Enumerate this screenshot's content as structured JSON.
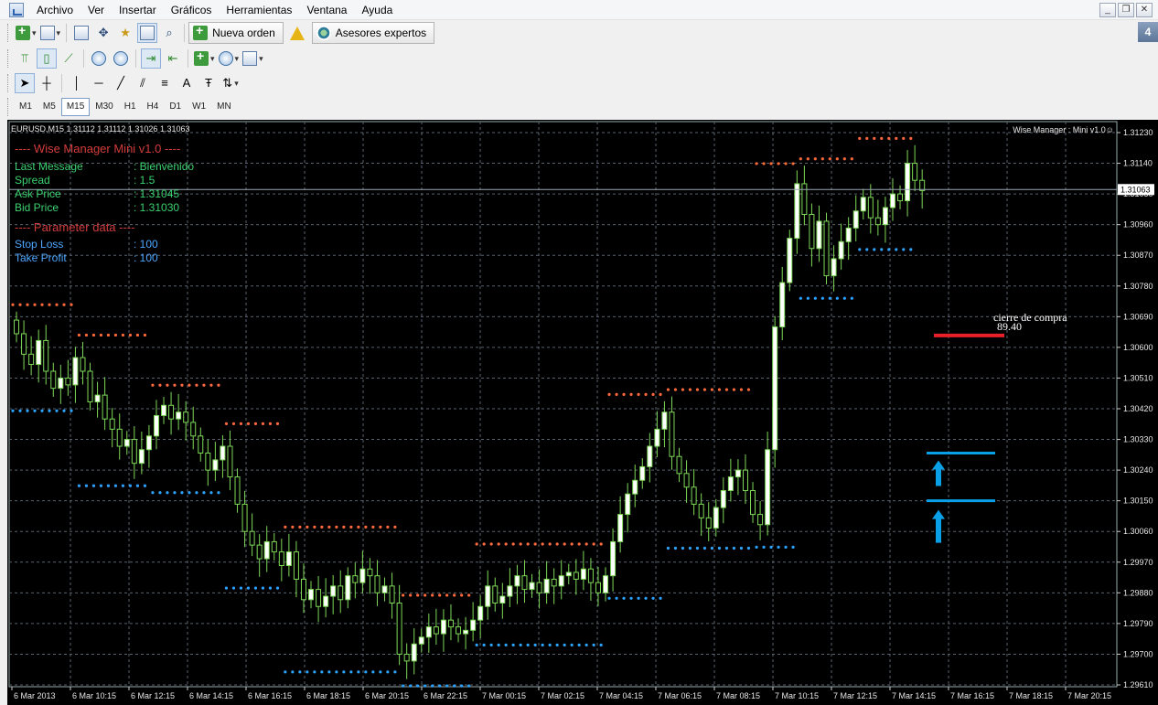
{
  "menubar": {
    "items": [
      "Archivo",
      "Ver",
      "Insertar",
      "Gráficos",
      "Herramientas",
      "Ventana",
      "Ayuda"
    ]
  },
  "window_controls": [
    "_",
    "❐",
    "✕"
  ],
  "toolbar1": {
    "new_order_label": "Nueva orden",
    "expert_advisors_label": "Asesores expertos",
    "badge": "4"
  },
  "timeframes": [
    "M1",
    "M5",
    "M15",
    "M30",
    "H1",
    "H4",
    "D1",
    "W1",
    "MN"
  ],
  "active_timeframe": "M15",
  "chart": {
    "header": "EURUSD,M15  1.31112 1.31112 1.31026 1.31063",
    "ea_label": "Wise Manager : Mini v1.0☺",
    "current_price": "1.31063",
    "colors": {
      "background": "#000000",
      "grid": "#5a6470",
      "bull": "#ffffff",
      "bear": "#7ed957",
      "wick": "#7ed957",
      "resistance_dots": "#ff6a3d",
      "support_dots": "#2ba3ff",
      "close_line": "#e8202a",
      "arrow_blue": "#0aa0e8"
    }
  },
  "panel": {
    "title": "---- Wise Manager Mini v1.0 ----",
    "rows": [
      {
        "label": "Last Message",
        "value": ": Bienvenido"
      },
      {
        "label": "Spread",
        "value": ": 1.5"
      },
      {
        "label": "Ask Price",
        "value": ": 1.31045"
      },
      {
        "label": "Bid Price",
        "value": ": 1.31030"
      }
    ],
    "param_title": "---- Parameter data ----",
    "params": [
      {
        "label": "Stop Loss",
        "value": ": 100"
      },
      {
        "label": "Take Profit",
        "value": ": 100"
      }
    ]
  },
  "annotation": {
    "line1": "cierre de compra",
    "line2": "89.40"
  },
  "chart_data": {
    "type": "candlestick",
    "symbol": "EURUSD",
    "timeframe": "M15",
    "y_ticks": [
      "1.31230",
      "1.31140",
      "1.31050",
      "1.30960",
      "1.30870",
      "1.30780",
      "1.30690",
      "1.30600",
      "1.30510",
      "1.30420",
      "1.30330",
      "1.30240",
      "1.30150",
      "1.30060",
      "1.29970",
      "1.29880",
      "1.29790",
      "1.29700",
      "1.29610"
    ],
    "x_ticks": [
      "6 Mar 2013",
      "6 Mar 10:15",
      "6 Mar 12:15",
      "6 Mar 14:15",
      "6 Mar 16:15",
      "6 Mar 18:15",
      "6 Mar 20:15",
      "6 Mar 22:15",
      "7 Mar 00:15",
      "7 Mar 02:15",
      "7 Mar 04:15",
      "7 Mar 06:15",
      "7 Mar 08:15",
      "7 Mar 10:15",
      "7 Mar 12:15",
      "7 Mar 14:15",
      "7 Mar 16:15",
      "7 Mar 18:15",
      "7 Mar 20:15"
    ],
    "ylim": [
      1.2961,
      1.3123
    ],
    "bid_line": 1.31063,
    "close_marker_price": 1.30635,
    "entry_levels": [
      1.3029,
      1.3015
    ],
    "closes": [
      1.3064,
      1.3058,
      1.3055,
      1.3062,
      1.3053,
      1.3048,
      1.3051,
      1.3049,
      1.3057,
      1.3053,
      1.3044,
      1.3046,
      1.3039,
      1.3036,
      1.3031,
      1.3033,
      1.3026,
      1.303,
      1.3034,
      1.304,
      1.3043,
      1.3039,
      1.3041,
      1.3038,
      1.3034,
      1.3029,
      1.3024,
      1.3027,
      1.3031,
      1.3022,
      1.3014,
      1.3006,
      1.3002,
      1.2998,
      1.3003,
      1.3,
      1.2996,
      1.3,
      1.2992,
      1.2986,
      1.2989,
      1.2984,
      1.2987,
      1.299,
      1.2986,
      1.2993,
      1.2991,
      1.2995,
      1.2993,
      1.2988,
      1.299,
      1.2985,
      1.297,
      1.2968,
      1.2973,
      1.2975,
      1.2978,
      1.2976,
      1.298,
      1.2978,
      1.2976,
      1.2977,
      1.298,
      1.2984,
      1.299,
      1.2985,
      1.2987,
      1.299,
      1.2993,
      1.2989,
      1.2991,
      1.2988,
      1.2992,
      1.299,
      1.2993,
      1.2994,
      1.2992,
      1.2995,
      1.2991,
      1.2988,
      1.2993,
      1.3003,
      1.3011,
      1.3017,
      1.3021,
      1.3025,
      1.3031,
      1.3036,
      1.3041,
      1.3028,
      1.3023,
      1.3019,
      1.3014,
      1.301,
      1.3007,
      1.3013,
      1.3018,
      1.3022,
      1.3024,
      1.3018,
      1.3011,
      1.3008,
      1.303,
      1.3066,
      1.3079,
      1.3092,
      1.3108,
      1.3099,
      1.3089,
      1.3097,
      1.3081,
      1.3086,
      1.3091,
      1.3095,
      1.31,
      1.3104,
      1.3098,
      1.3096,
      1.3101,
      1.3105,
      1.3103,
      1.3114,
      1.3109,
      1.3106
    ]
  }
}
